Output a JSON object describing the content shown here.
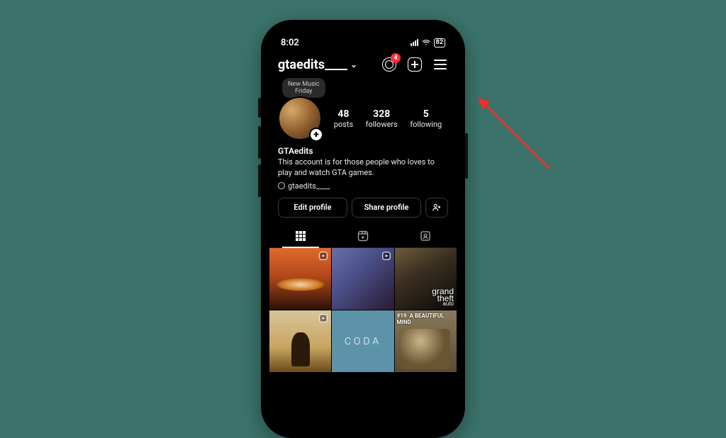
{
  "status": {
    "time": "8:02",
    "battery": "82"
  },
  "header": {
    "username": "gtaedits____",
    "badge_count": "4"
  },
  "highlight_tip": "New Music\nFriday",
  "stats": {
    "posts": {
      "n": "48",
      "l": "posts"
    },
    "followers": {
      "n": "328",
      "l": "followers"
    },
    "following": {
      "n": "5",
      "l": "following"
    }
  },
  "profile": {
    "display_name": "GTAedits",
    "bio": "This account is for those people who loves to play and watch GTA games.",
    "handle": "gtaedits____"
  },
  "buttons": {
    "edit": "Edit profile",
    "share": "Share profile"
  },
  "grid": {
    "gta_logo_top": "grand",
    "gta_logo_mid": "theft",
    "gta_logo_bot": "auto",
    "coda": "CODA",
    "tile6_tag": "#19",
    "tile6_title": "A BEAUTIFUL MIND"
  }
}
